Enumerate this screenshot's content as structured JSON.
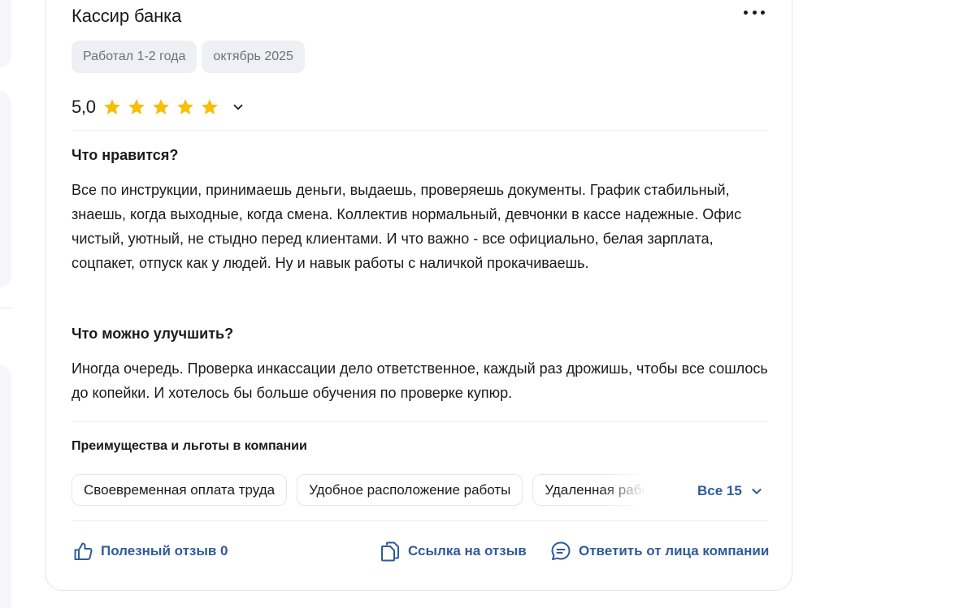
{
  "review": {
    "title": "Кассир банка",
    "tags": [
      "Работал 1-2 года",
      "октябрь 2025"
    ],
    "rating": {
      "value": "5,0",
      "stars": 5,
      "max": 5
    },
    "likes": {
      "heading": "Что нравится?",
      "text": "Все по инструкции, принимаешь деньги, выдаешь, проверяешь документы. График стабильный, знаешь, когда выходные, когда смена. Коллектив нормальный, девчонки в кассе надежные. Офис чистый, уютный, не стыдно перед клиентами. И что важно - все официально, белая зарплата, соцпакет, отпуск как у людей. Ну и навык работы с наличкой прокачиваешь."
    },
    "improve": {
      "heading": "Что можно улучшить?",
      "text": "Иногда очередь. Проверка инкассации дело ответственное, каждый раз дрожишь, чтобы все сошлось до копейки. И хотелось бы больше обучения по проверке купюр."
    },
    "benefits": {
      "heading": "Преимущества и льготы в компании",
      "chips": [
        "Своевременная оплата труда",
        "Удобное расположение работы",
        "Удаленная работа"
      ],
      "all_label": "Все 15"
    },
    "actions": {
      "helpful": "Полезный отзыв 0",
      "link": "Ссылка на отзыв",
      "reply": "Ответить от лица компании"
    }
  },
  "colors": {
    "accent": "#2f5b9c",
    "star": "#f5bf0a",
    "tag_bg": "#eef0f3",
    "border": "#e3e6ea"
  },
  "icons": [
    "more-icon",
    "star-icon",
    "chevron-down-icon",
    "thumbs-up-icon",
    "copy-link-icon",
    "chat-icon"
  ]
}
